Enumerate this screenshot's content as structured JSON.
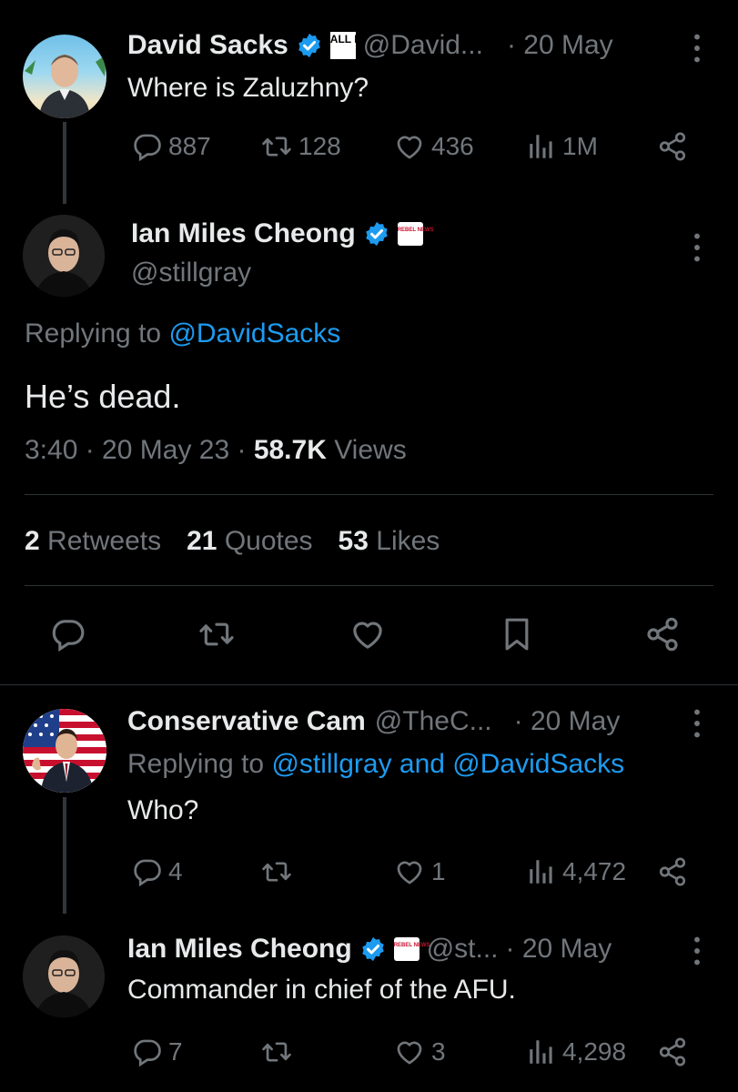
{
  "tweet1": {
    "name": "David Sacks",
    "handle": "@David...",
    "date": "· 20 May",
    "badge_text": "ALL IN",
    "text": "Where is Zaluzhny?",
    "replies": "887",
    "retweets": "128",
    "likes": "436",
    "views": "1M"
  },
  "main": {
    "name": "Ian Miles Cheong",
    "handle": "@stillgray",
    "badge_text": "REBEL NEWS",
    "replying_prefix": "Replying to",
    "replying_to": "@DavidSacks",
    "text": "He’s dead.",
    "time": "3:40",
    "date": "· 20 May 23 ·",
    "views_count": "58.7K",
    "views_label": "Views",
    "retweets_count": "2",
    "retweets_label": "Retweets",
    "quotes_count": "21",
    "quotes_label": "Quotes",
    "likes_count": "53",
    "likes_label": "Likes"
  },
  "reply1": {
    "name": "Conservative Cam",
    "handle": "@TheC...",
    "date": "· 20 May",
    "replying_prefix": "Replying to",
    "replying_to": "@stillgray and @DavidSacks",
    "text": "Who?",
    "replies": "4",
    "likes": "1",
    "views": "4,472"
  },
  "reply2": {
    "name": "Ian Miles Cheong",
    "handle": "@st...",
    "date": "· 20 May",
    "badge_text": "REBEL NEWS",
    "text": "Commander in chief of the AFU.",
    "replies": "7",
    "likes": "3",
    "views": "4,298"
  },
  "colors": {
    "background": "#000000",
    "text": "#e7e9ea",
    "secondary": "#71767b",
    "accent": "#1d9bf0",
    "divider": "#2f3336"
  },
  "icons": [
    "reply-icon",
    "retweet-icon",
    "like-icon",
    "views-icon",
    "share-icon",
    "bookmark-icon",
    "verified-icon",
    "more-icon"
  ]
}
